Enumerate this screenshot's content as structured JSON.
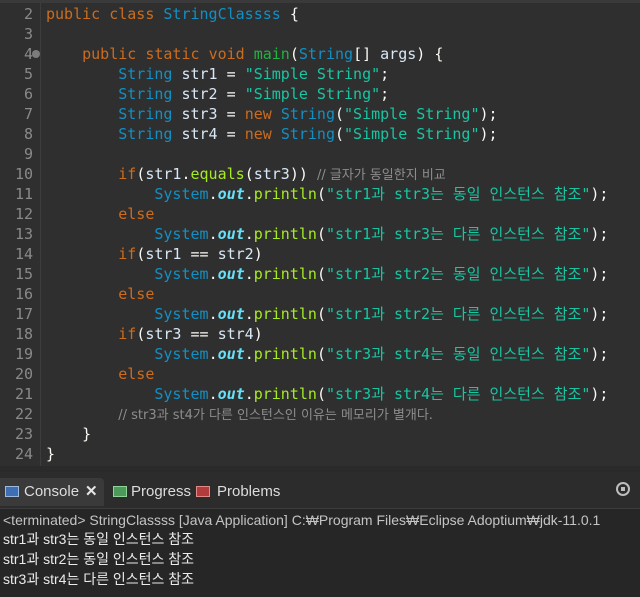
{
  "editor": {
    "lines": [
      {
        "n": "2",
        "tokens": [
          [
            "kw",
            "public "
          ],
          [
            "kw",
            "class "
          ],
          [
            "ty",
            "StringClassss "
          ],
          [
            "pl",
            "{"
          ]
        ]
      },
      {
        "n": "3",
        "tokens": []
      },
      {
        "n": "4",
        "tokens": [
          [
            "pl",
            "    "
          ],
          [
            "kw",
            "public "
          ],
          [
            "kw",
            "static "
          ],
          [
            "kw",
            "void "
          ],
          [
            "fn",
            "main"
          ],
          [
            "pl",
            "("
          ],
          [
            "ty",
            "String"
          ],
          [
            "pl",
            "[] "
          ],
          [
            "var",
            "args"
          ],
          [
            "pl",
            ") {"
          ]
        ],
        "fold": true
      },
      {
        "n": "5",
        "tokens": [
          [
            "pl",
            "        "
          ],
          [
            "ty",
            "String "
          ],
          [
            "var",
            "str1"
          ],
          [
            "pl",
            " = "
          ],
          [
            "st",
            "\"Simple String\""
          ],
          [
            "pl",
            ";"
          ]
        ]
      },
      {
        "n": "6",
        "tokens": [
          [
            "pl",
            "        "
          ],
          [
            "ty",
            "String "
          ],
          [
            "var",
            "str2"
          ],
          [
            "pl",
            " = "
          ],
          [
            "st",
            "\"Simple String\""
          ],
          [
            "pl",
            ";"
          ]
        ]
      },
      {
        "n": "7",
        "tokens": [
          [
            "pl",
            "        "
          ],
          [
            "ty",
            "String "
          ],
          [
            "var",
            "str3"
          ],
          [
            "pl",
            " = "
          ],
          [
            "kw",
            "new "
          ],
          [
            "ty",
            "String"
          ],
          [
            "pl",
            "("
          ],
          [
            "st",
            "\"Simple String\""
          ],
          [
            "pl",
            ");"
          ]
        ]
      },
      {
        "n": "8",
        "tokens": [
          [
            "pl",
            "        "
          ],
          [
            "ty",
            "String "
          ],
          [
            "var",
            "str4"
          ],
          [
            "pl",
            " = "
          ],
          [
            "kw",
            "new "
          ],
          [
            "ty",
            "String"
          ],
          [
            "pl",
            "("
          ],
          [
            "st",
            "\"Simple String\""
          ],
          [
            "pl",
            ");"
          ]
        ]
      },
      {
        "n": "9",
        "tokens": []
      },
      {
        "n": "10",
        "tokens": [
          [
            "pl",
            "        "
          ],
          [
            "kw",
            "if"
          ],
          [
            "pl",
            "("
          ],
          [
            "var",
            "str1"
          ],
          [
            "pl",
            "."
          ],
          [
            "mth",
            "equals"
          ],
          [
            "pl",
            "("
          ],
          [
            "var",
            "str3"
          ],
          [
            "pl",
            ")) "
          ],
          [
            "cm",
            "// 글자가 동일한지 비교"
          ]
        ]
      },
      {
        "n": "11",
        "tokens": [
          [
            "pl",
            "            "
          ],
          [
            "sys",
            "System"
          ],
          [
            "pl",
            "."
          ],
          [
            "fld",
            "out"
          ],
          [
            "pl",
            "."
          ],
          [
            "mth",
            "println"
          ],
          [
            "pl",
            "("
          ],
          [
            "st",
            "\"str1과 str3는 동일 인스턴스 참조\""
          ],
          [
            "pl",
            ");"
          ]
        ]
      },
      {
        "n": "12",
        "tokens": [
          [
            "pl",
            "        "
          ],
          [
            "kw",
            "else"
          ]
        ]
      },
      {
        "n": "13",
        "tokens": [
          [
            "pl",
            "            "
          ],
          [
            "sys",
            "System"
          ],
          [
            "pl",
            "."
          ],
          [
            "fld",
            "out"
          ],
          [
            "pl",
            "."
          ],
          [
            "mth",
            "println"
          ],
          [
            "pl",
            "("
          ],
          [
            "st",
            "\"str1과 str3는 다른 인스턴스 참조\""
          ],
          [
            "pl",
            ");"
          ]
        ]
      },
      {
        "n": "14",
        "tokens": [
          [
            "pl",
            "        "
          ],
          [
            "kw",
            "if"
          ],
          [
            "pl",
            "("
          ],
          [
            "var",
            "str1"
          ],
          [
            "pl",
            " == "
          ],
          [
            "var",
            "str2"
          ],
          [
            "pl",
            ")"
          ]
        ]
      },
      {
        "n": "15",
        "tokens": [
          [
            "pl",
            "            "
          ],
          [
            "sys",
            "System"
          ],
          [
            "pl",
            "."
          ],
          [
            "fld",
            "out"
          ],
          [
            "pl",
            "."
          ],
          [
            "mth",
            "println"
          ],
          [
            "pl",
            "("
          ],
          [
            "st",
            "\"str1과 str2는 동일 인스턴스 참조\""
          ],
          [
            "pl",
            ");"
          ]
        ]
      },
      {
        "n": "16",
        "tokens": [
          [
            "pl",
            "        "
          ],
          [
            "kw",
            "else"
          ]
        ]
      },
      {
        "n": "17",
        "tokens": [
          [
            "pl",
            "            "
          ],
          [
            "sys",
            "System"
          ],
          [
            "pl",
            "."
          ],
          [
            "fld",
            "out"
          ],
          [
            "pl",
            "."
          ],
          [
            "mth",
            "println"
          ],
          [
            "pl",
            "("
          ],
          [
            "st",
            "\"str1과 str2는 다른 인스턴스 참조\""
          ],
          [
            "pl",
            ");"
          ]
        ]
      },
      {
        "n": "18",
        "tokens": [
          [
            "pl",
            "        "
          ],
          [
            "kw",
            "if"
          ],
          [
            "pl",
            "("
          ],
          [
            "var",
            "str3"
          ],
          [
            "pl",
            " == "
          ],
          [
            "var",
            "str4"
          ],
          [
            "pl",
            ")"
          ]
        ]
      },
      {
        "n": "19",
        "tokens": [
          [
            "pl",
            "            "
          ],
          [
            "sys",
            "System"
          ],
          [
            "pl",
            "."
          ],
          [
            "fld",
            "out"
          ],
          [
            "pl",
            "."
          ],
          [
            "mth",
            "println"
          ],
          [
            "pl",
            "("
          ],
          [
            "st",
            "\"str3과 str4는 동일 인스턴스 참조\""
          ],
          [
            "pl",
            ");"
          ]
        ]
      },
      {
        "n": "20",
        "tokens": [
          [
            "pl",
            "        "
          ],
          [
            "kw",
            "else"
          ]
        ]
      },
      {
        "n": "21",
        "tokens": [
          [
            "pl",
            "            "
          ],
          [
            "sys",
            "System"
          ],
          [
            "pl",
            "."
          ],
          [
            "fld",
            "out"
          ],
          [
            "pl",
            "."
          ],
          [
            "mth",
            "println"
          ],
          [
            "pl",
            "("
          ],
          [
            "st",
            "\"str3과 str4는 다른 인스턴스 참조\""
          ],
          [
            "pl",
            ");"
          ]
        ]
      },
      {
        "n": "22",
        "tokens": [
          [
            "pl",
            "        "
          ],
          [
            "cm",
            "// str3과 st4가 다른 인스턴스인 이유는 메모리가 별개다."
          ]
        ]
      },
      {
        "n": "23",
        "tokens": [
          [
            "pl",
            "    }"
          ]
        ]
      },
      {
        "n": "24",
        "tokens": [
          [
            "pl",
            "}"
          ]
        ]
      }
    ]
  },
  "console": {
    "tabs": [
      {
        "label": "Console",
        "icon": "console-icon",
        "active": true
      },
      {
        "label": "Progress",
        "icon": "progress-icon"
      },
      {
        "label": "Problems",
        "icon": "problems-icon"
      }
    ],
    "close_label": "✕",
    "terminated_text": "<terminated> StringClassss [Java Application] C:₩Program Files₩Eclipse Adoptium₩jdk-11.0.1",
    "output": [
      "str1과 str3는 동일 인스턴스 참조",
      "str1과 str2는 동일 인스턴스 참조",
      "str3과 str4는 다른 인스턴스 참조"
    ]
  }
}
